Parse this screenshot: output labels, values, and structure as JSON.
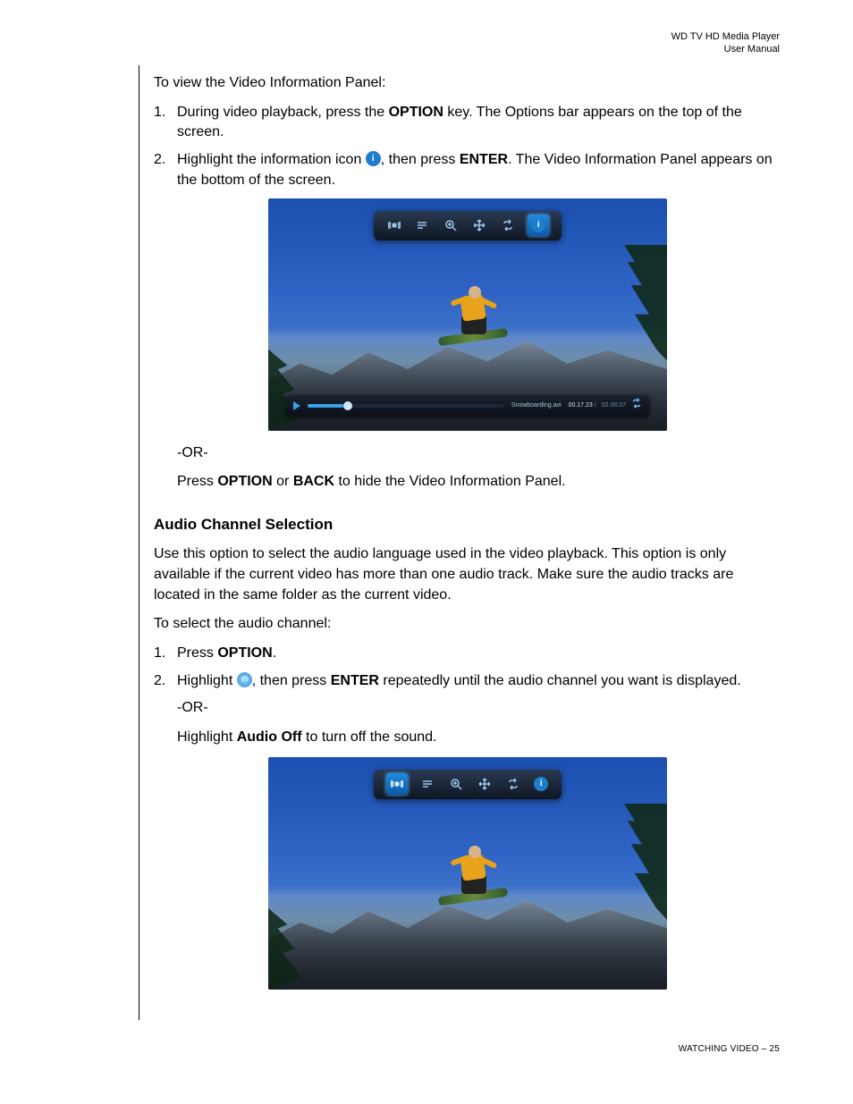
{
  "header": {
    "line1": "WD TV HD Media Player",
    "line2": "User Manual"
  },
  "intro": "To view the Video Information Panel:",
  "steps1": [
    {
      "num": "1.",
      "pre": "During video playback, press the ",
      "bold1": "OPTION",
      "post": " key. The Options bar appears on the top of the screen."
    },
    {
      "num": "2.",
      "pre": "Highlight the information icon ",
      "mid": ", then press ",
      "bold1": "ENTER",
      "post": ". The Video Information Panel appears on the bottom of the screen."
    }
  ],
  "or": "-OR-",
  "hide_panel": {
    "pre": "Press ",
    "b1": "OPTION",
    "mid": " or ",
    "b2": "BACK",
    "post": " to hide the Video Information Panel."
  },
  "section2": {
    "title": "Audio Channel Selection",
    "para": "Use this option to select the audio language used in the video playback. This option is only available if the current video has more than one audio track. Make sure the audio tracks are located in the same folder as the current video.",
    "lead": "To select the audio channel:"
  },
  "steps2": [
    {
      "num": "1.",
      "pre": "Press ",
      "b1": "OPTION",
      "post": "."
    },
    {
      "num": "2.",
      "pre": "Highlight ",
      "mid": ", then press ",
      "b1": "ENTER",
      "post": " repeatedly until the audio channel you want is displayed."
    }
  ],
  "audio_off": {
    "pre": "Highlight ",
    "b1": "Audio Off",
    "post": " to turn off the sound."
  },
  "fig1": {
    "filename": "Snowboarding.avi",
    "time": "00.17.23",
    "sep": " / ",
    "duration": "02.08.07"
  },
  "footer": "WATCHING VIDEO – 25"
}
